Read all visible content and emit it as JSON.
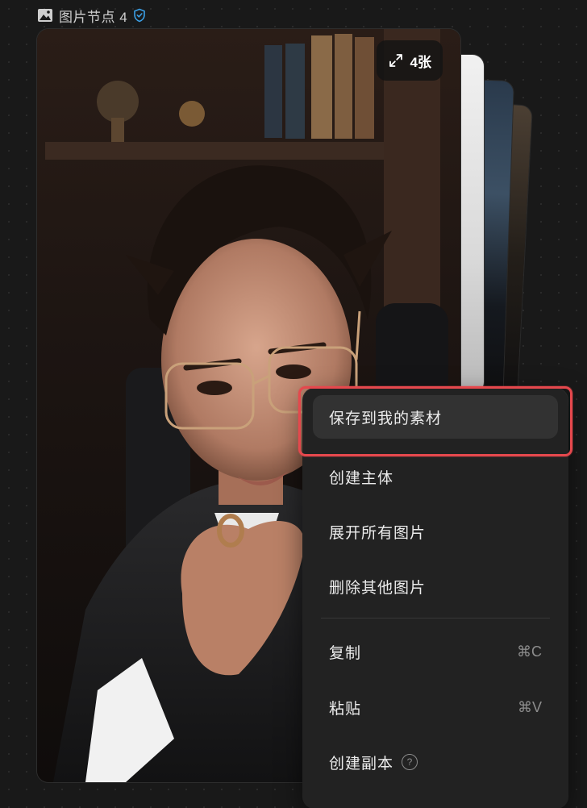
{
  "node": {
    "title": "图片节点 4",
    "image_icon": "image-icon",
    "verified_icon": "shield-check-icon",
    "accent_color": "#3ba0e6"
  },
  "image_card": {
    "count_label": "4张",
    "expand_icon": "expand-icon"
  },
  "context_menu": {
    "items": [
      {
        "label": "保存到我的素材",
        "shortcut": ""
      },
      {
        "label": "创建主体",
        "shortcut": ""
      },
      {
        "label": "展开所有图片",
        "shortcut": ""
      },
      {
        "label": "删除其他图片",
        "shortcut": ""
      },
      {
        "label": "复制",
        "shortcut": "⌘C"
      },
      {
        "label": "粘贴",
        "shortcut": "⌘V"
      },
      {
        "label": "创建副本",
        "shortcut": "",
        "help_icon": "help-circle-icon",
        "help_glyph": "?"
      }
    ],
    "highlight_color": "#e5484d"
  }
}
